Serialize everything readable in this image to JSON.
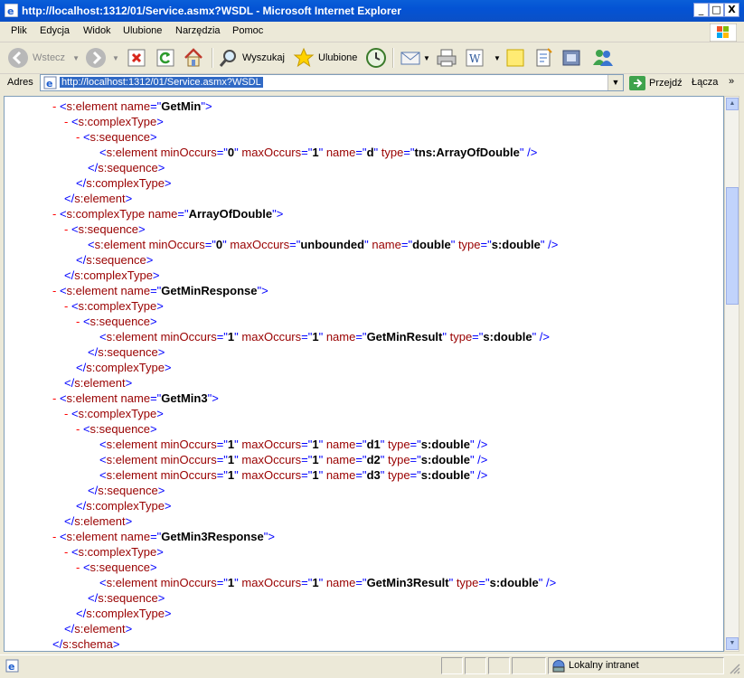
{
  "window": {
    "title": "http://localhost:1312/01/Service.asmx?WSDL - Microsoft Internet Explorer",
    "controls": {
      "minimize": "_",
      "maximize": "□",
      "close": "X"
    }
  },
  "menu": {
    "items": [
      {
        "label": "Plik"
      },
      {
        "label": "Edycja"
      },
      {
        "label": "Widok"
      },
      {
        "label": "Ulubione"
      },
      {
        "label": "Narzędzia"
      },
      {
        "label": "Pomoc"
      }
    ]
  },
  "toolbar": {
    "back": "Wstecz",
    "search": "Wyszukaj",
    "favorites": "Ulubione"
  },
  "address": {
    "label": "Adres",
    "url": "http://localhost:1312/01/Service.asmx?WSDL",
    "go": "Przejdź",
    "links": "Łącza"
  },
  "colors": {
    "markup": "#FF0000",
    "tag": "#990000",
    "punct": "#0000FF",
    "value": "#000000"
  },
  "xml_lines": [
    "- <s:element name=\"GetMin\">",
    "- <s:complexType>",
    "- <s:sequence>",
    "<s:element minOccurs=\"0\" maxOccurs=\"1\" name=\"d\" type=\"tns:ArrayOfDouble\" />",
    "</s:sequence>",
    "</s:complexType>",
    "</s:element>",
    "- <s:complexType name=\"ArrayOfDouble\">",
    "- <s:sequence>",
    "<s:element minOccurs=\"0\" maxOccurs=\"unbounded\" name=\"double\" type=\"s:double\" />",
    "</s:sequence>",
    "</s:complexType>",
    "- <s:element name=\"GetMinResponse\">",
    "- <s:complexType>",
    "- <s:sequence>",
    "<s:element minOccurs=\"1\" maxOccurs=\"1\" name=\"GetMinResult\" type=\"s:double\" />",
    "</s:sequence>",
    "</s:complexType>",
    "</s:element>",
    "- <s:element name=\"GetMin3\">",
    "- <s:complexType>",
    "- <s:sequence>",
    "<s:element minOccurs=\"1\" maxOccurs=\"1\" name=\"d1\" type=\"s:double\" />",
    "<s:element minOccurs=\"1\" maxOccurs=\"1\" name=\"d2\" type=\"s:double\" />",
    "<s:element minOccurs=\"1\" maxOccurs=\"1\" name=\"d3\" type=\"s:double\" />",
    "</s:sequence>",
    "</s:complexType>",
    "</s:element>",
    "- <s:element name=\"GetMin3Response\">",
    "- <s:complexType>",
    "- <s:sequence>",
    "<s:element minOccurs=\"1\" maxOccurs=\"1\" name=\"GetMin3Result\" type=\"s:double\" />",
    "</s:sequence>",
    "</s:complexType>",
    "</s:element>",
    "</s:schema>"
  ],
  "status": {
    "zone": "Lokalny intranet"
  }
}
